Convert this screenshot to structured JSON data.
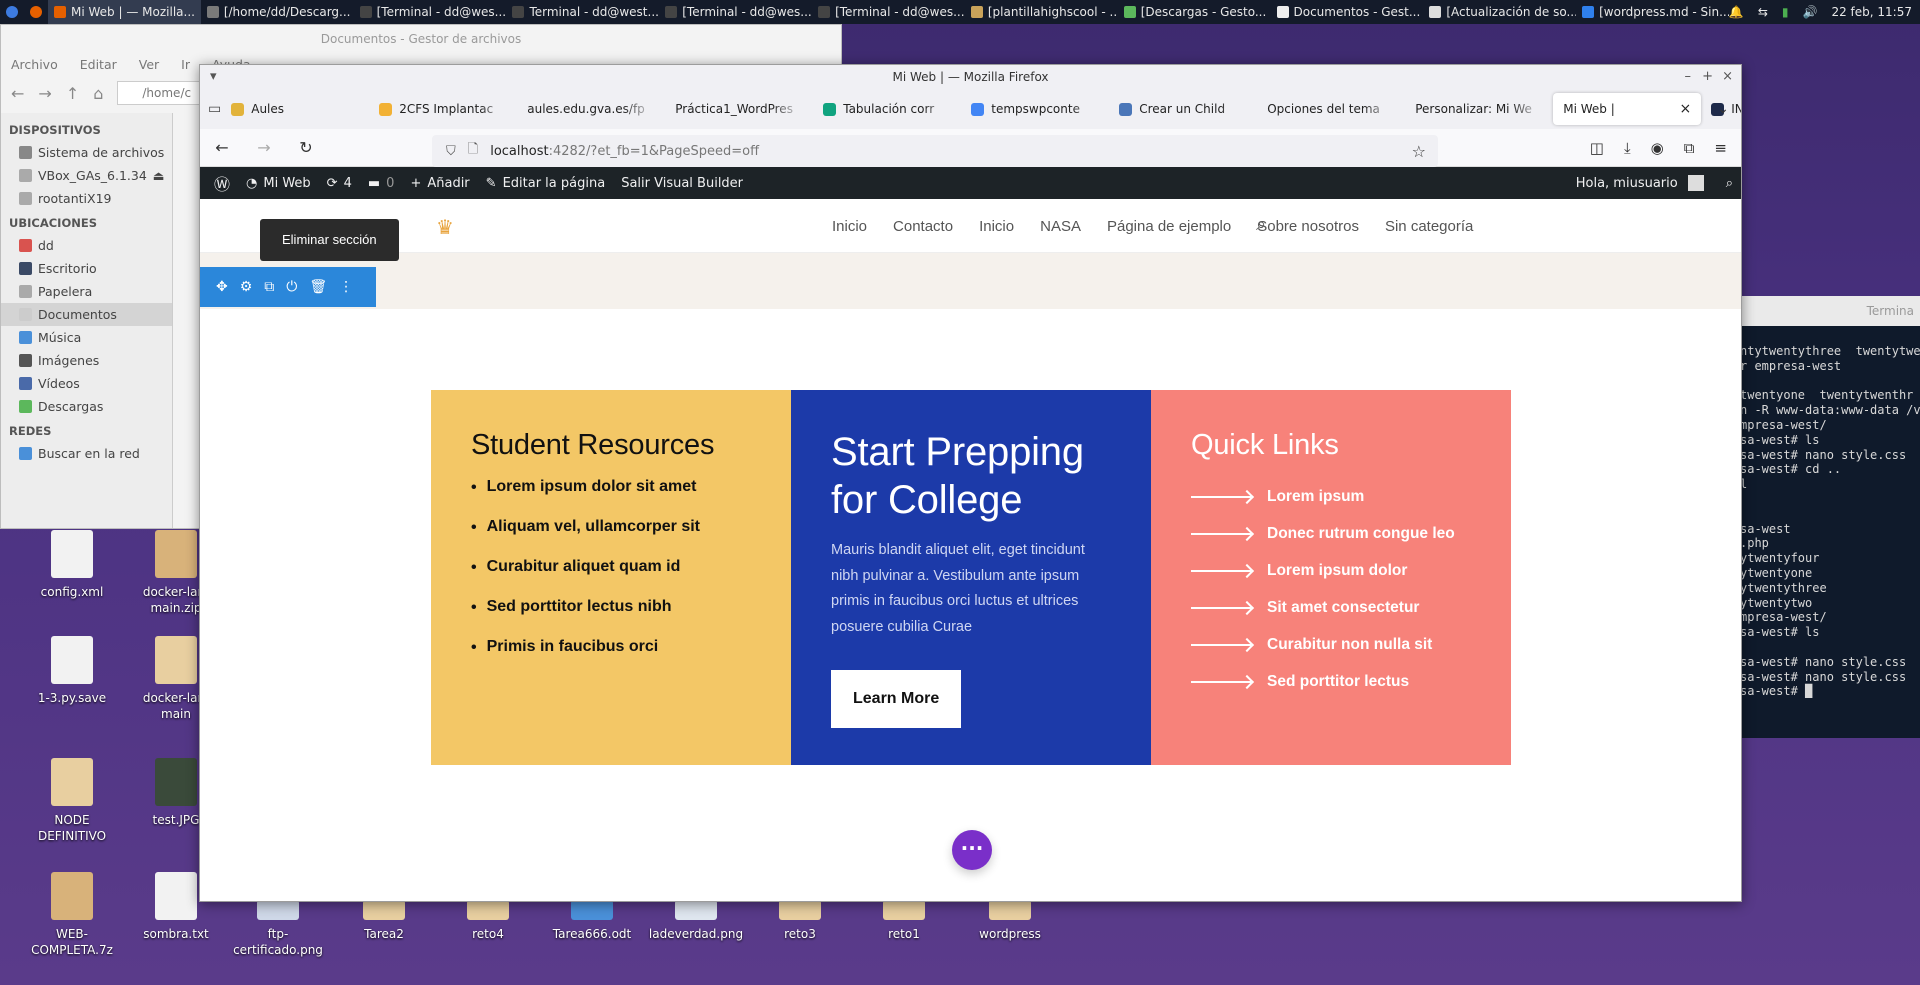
{
  "panel": {
    "tasks": [
      {
        "label": "Mi Web | — Mozilla...",
        "color": "#e66000",
        "active": true
      },
      {
        "label": "[/home/dd/Descarg...",
        "color": "#7a7a7a"
      },
      {
        "label": "[Terminal - dd@wes...",
        "color": "#444"
      },
      {
        "label": "Terminal - dd@west...",
        "color": "#444"
      },
      {
        "label": "[Terminal - dd@wes...",
        "color": "#444"
      },
      {
        "label": "[Terminal - dd@wes...",
        "color": "#444"
      },
      {
        "label": "[plantillahighscool - ...",
        "color": "#caa35a"
      },
      {
        "label": "[Descargas - Gesto...",
        "color": "#5cb85c"
      },
      {
        "label": "Documentos - Gest...",
        "color": "#eeeeee"
      },
      {
        "label": "[Actualización de so...",
        "color": "#dddddd"
      },
      {
        "label": "[wordpress.md - Sin...",
        "color": "#2f80ed"
      }
    ],
    "clock": "22 feb, 11:57"
  },
  "file_manager": {
    "title": "Documentos - Gestor de archivos",
    "menu": [
      "Archivo",
      "Editar",
      "Ver",
      "Ir",
      "Ayuda"
    ],
    "path": "/home/c",
    "sections": [
      {
        "title": "DISPOSITIVOS",
        "items": [
          "Sistema de archivos",
          "VBox_GAs_6.1.34",
          "rootantiX19"
        ]
      },
      {
        "title": "UBICACIONES",
        "items": [
          "dd",
          "Escritorio",
          "Papelera",
          "Documentos",
          "Música",
          "Imágenes",
          "Vídeos",
          "Descargas"
        ]
      },
      {
        "title": "REDES",
        "items": [
          "Buscar en la red"
        ]
      }
    ]
  },
  "terminal": {
    "title": "Termina",
    "lines": [
      "ntytwentythree  twentytwen",
      "r empresa-west",
      "",
      "twentyone  twentytwenthr",
      "n -R www-data:www-data /va",
      "mpresa-west/",
      "sa-west# ls",
      "sa-west# nano style.css",
      "sa-west# cd ..",
      "l",
      "",
      "",
      "sa-west",
      ".php",
      "ytwentyfour",
      "ytwentyone",
      "ytwentythree",
      "ytwentytwo",
      "mpresa-west/",
      "sa-west# ls",
      "",
      "sa-west# nano style.css",
      "sa-west# nano style.css",
      "sa-west# █"
    ]
  },
  "desktop_icons": [
    {
      "label": "config.xml",
      "color": "#f2f2f2"
    },
    {
      "label": "docker-lam main.zip",
      "color": "#d8b27a"
    },
    {
      "label": "1-3.py.save",
      "color": "#f2f2f2"
    },
    {
      "label": "docker-lam main",
      "color": "#e8cfa0"
    },
    {
      "label": "NODE DEFINITIVO",
      "color": "#e8cfa0"
    },
    {
      "label": "test.JPG",
      "color": "#3a4a3a"
    },
    {
      "label": "WEB-COMPLETA.7z",
      "color": "#d8b27a"
    },
    {
      "label": "sombra.txt",
      "color": "#f2f2f2"
    },
    {
      "label": "ftp-certificado.png",
      "color": "#cfd8e8"
    },
    {
      "label": "Tarea2",
      "color": "#e8cfa0"
    },
    {
      "label": "reto4",
      "color": "#e8cfa0"
    },
    {
      "label": "Tarea666.odt",
      "color": "#4a90d9"
    },
    {
      "label": "ladeverdad.png",
      "color": "#dfe6ef"
    },
    {
      "label": "reto3",
      "color": "#e8cfa0"
    },
    {
      "label": "reto1",
      "color": "#e8cfa0"
    },
    {
      "label": "wordpress",
      "color": "#e8cfa0"
    }
  ],
  "firefox": {
    "title": "Mi Web | — Mozilla Firefox",
    "tabs": [
      {
        "label": "Aules",
        "color": "#e2b33b"
      },
      {
        "label": "2CFS Implantac",
        "color": "#f2b134"
      },
      {
        "label": "aules.edu.gva.es/fp",
        "color": ""
      },
      {
        "label": "Práctica1_WordPres",
        "color": ""
      },
      {
        "label": "Tabulación corr",
        "color": "#10a37f"
      },
      {
        "label": "tempswpconte",
        "color": "#4285f4"
      },
      {
        "label": "Crear un Child",
        "color": "#4a76b8"
      },
      {
        "label": "Opciones del tema",
        "color": ""
      },
      {
        "label": "Personalizar: Mi We",
        "color": ""
      },
      {
        "label": "Mi Web |",
        "color": "",
        "active": true
      },
      {
        "label": "INICIO DE INST",
        "color": "#1e2a4a"
      }
    ],
    "url_host": "localhost",
    "url_rest": ":4282/?et_fb=1&PageSpeed=off"
  },
  "wp_admin": {
    "site_name": "Mi Web",
    "updates": "4",
    "comments": "0",
    "add": "Añadir",
    "edit": "Editar la página",
    "exit": "Salir Visual Builder",
    "greeting": "Hola, miusuario"
  },
  "site": {
    "menu": [
      "Inicio",
      "Contacto",
      "Inicio",
      "NASA",
      "Página de ejemplo",
      "Sobre nosotros",
      "Sin categoría"
    ],
    "tooltip": "Eliminar sección",
    "col1": {
      "title": "Student Resources",
      "items": [
        "Lorem ipsum dolor sit amet",
        "Aliquam vel, ullamcorper sit",
        "Curabitur aliquet quam id",
        "Sed porttitor lectus nibh",
        "Primis in faucibus orci"
      ]
    },
    "col2": {
      "title": "Start Prepping for College",
      "text": "Mauris blandit aliquet elit, eget tincidunt nibh pulvinar a. Vestibulum ante ipsum primis in faucibus orci luctus et ultrices posuere cubilia Curae",
      "button": "Learn More"
    },
    "col3": {
      "title": "Quick Links",
      "links": [
        "Lorem ipsum",
        "Donec rutrum congue leo",
        "Lorem ipsum dolor",
        "Sit amet consectetur",
        "Curabitur non nulla sit",
        "Sed porttitor lectus"
      ]
    },
    "colors": {
      "yellow": "#f3c766",
      "blue": "#1c3aa9",
      "coral": "#f7827a",
      "builder_blue": "#2b87da",
      "fab_purple": "#7a2fc9"
    }
  }
}
